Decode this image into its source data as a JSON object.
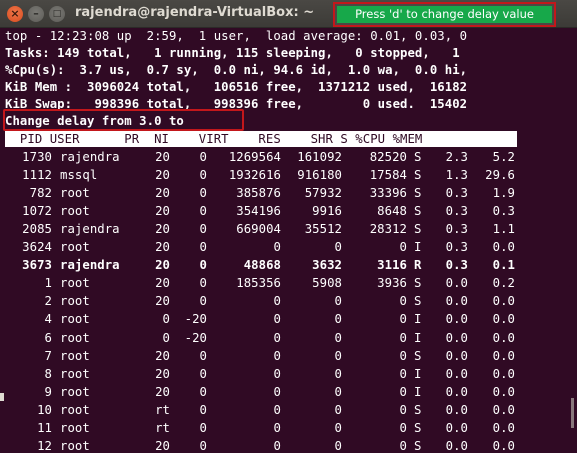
{
  "window": {
    "title": "rajendra@rajendra-VirtualBox: ~",
    "close_glyph": "×",
    "min_glyph": "–",
    "max_glyph": "□"
  },
  "callout": {
    "text": "Press 'd' to change delay value"
  },
  "summary": {
    "line1": "top - 12:23:08 up  2:59,  1 user,  load average: 0.01, 0.03, 0",
    "line2": "Tasks: 149 total,   1 running, 115 sleeping,   0 stopped,   1",
    "line3": "%Cpu(s):  3.7 us,  0.7 sy,  0.0 ni, 94.6 id,  1.0 wa,  0.0 hi,",
    "line4": "KiB Mem :  3096024 total,   106516 free,  1371212 used,  16182",
    "line5": "KiB Swap:   998396 total,   998396 free,        0 used.  15402"
  },
  "prompt": {
    "text": "Change delay from 3.0 to"
  },
  "table": {
    "header": "  PID USER      PR  NI    VIRT    RES    SHR S %CPU %MEM",
    "columns": [
      "PID",
      "USER",
      "PR",
      "NI",
      "VIRT",
      "RES",
      "SHR",
      "S",
      "%CPU",
      "%MEM"
    ],
    "rows": [
      [
        "1730",
        "rajendra",
        "20",
        "0",
        "1269564",
        "161092",
        "82520",
        "S",
        "2.3",
        "5.2"
      ],
      [
        "1112",
        "mssql",
        "20",
        "0",
        "1932616",
        "916180",
        "17584",
        "S",
        "1.3",
        "29.6"
      ],
      [
        "782",
        "root",
        "20",
        "0",
        "385876",
        "57932",
        "33396",
        "S",
        "0.3",
        "1.9"
      ],
      [
        "1072",
        "root",
        "20",
        "0",
        "354196",
        "9916",
        "8648",
        "S",
        "0.3",
        "0.3"
      ],
      [
        "2085",
        "rajendra",
        "20",
        "0",
        "669004",
        "35512",
        "28312",
        "S",
        "0.3",
        "1.1"
      ],
      [
        "3624",
        "root",
        "20",
        "0",
        "0",
        "0",
        "0",
        "I",
        "0.3",
        "0.0"
      ],
      [
        "3673",
        "rajendra",
        "20",
        "0",
        "48868",
        "3632",
        "3116",
        "R",
        "0.3",
        "0.1"
      ],
      [
        "1",
        "root",
        "20",
        "0",
        "185356",
        "5908",
        "3936",
        "S",
        "0.0",
        "0.2"
      ],
      [
        "2",
        "root",
        "20",
        "0",
        "0",
        "0",
        "0",
        "S",
        "0.0",
        "0.0"
      ],
      [
        "4",
        "root",
        "0",
        "-20",
        "0",
        "0",
        "0",
        "I",
        "0.0",
        "0.0"
      ],
      [
        "6",
        "root",
        "0",
        "-20",
        "0",
        "0",
        "0",
        "I",
        "0.0",
        "0.0"
      ],
      [
        "7",
        "root",
        "20",
        "0",
        "0",
        "0",
        "0",
        "S",
        "0.0",
        "0.0"
      ],
      [
        "8",
        "root",
        "20",
        "0",
        "0",
        "0",
        "0",
        "I",
        "0.0",
        "0.0"
      ],
      [
        "9",
        "root",
        "20",
        "0",
        "0",
        "0",
        "0",
        "I",
        "0.0",
        "0.0"
      ],
      [
        "10",
        "root",
        "rt",
        "0",
        "0",
        "0",
        "0",
        "S",
        "0.0",
        "0.0"
      ],
      [
        "11",
        "root",
        "rt",
        "0",
        "0",
        "0",
        "0",
        "S",
        "0.0",
        "0.0"
      ],
      [
        "12",
        "root",
        "20",
        "0",
        "0",
        "0",
        "0",
        "S",
        "0.0",
        "0.0"
      ]
    ],
    "bold_row_index": 6
  },
  "colors": {
    "terminal_bg": "#300a24",
    "callout_bg": "#17a84a",
    "highlight_border": "#c3171b"
  }
}
